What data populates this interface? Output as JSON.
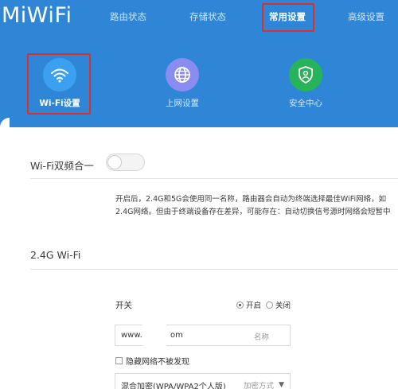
{
  "header": {
    "logo": "MiWiFi",
    "nav": [
      {
        "label": "路由状态"
      },
      {
        "label": "存储状态"
      },
      {
        "label": "常用设置"
      },
      {
        "label": "高级设置"
      }
    ],
    "tiles": [
      {
        "label": "Wi-Fi设置",
        "icon": "wifi-icon",
        "color": "#3ca0f0"
      },
      {
        "label": "上网设置",
        "icon": "globe-icon",
        "color": "#8a8cf2"
      },
      {
        "label": "安全中心",
        "icon": "shield-icon",
        "color": "#26b35a"
      }
    ]
  },
  "colors": {
    "header_bg": "#2f86d6",
    "highlight": "#d9312e"
  },
  "dual_band": {
    "title": "Wi-Fi双频合一",
    "description_line1": "开启后，2.4G和5G会使用同一名称，路由器会自动为终端选择最佳WiFi网络，如",
    "description_line2": "2.4G网络。但由于终端设备存在差异，可能存在：自动切换信号源时网络会短暂中"
  },
  "wifi24": {
    "title": "2.4G Wi-Fi",
    "switch_label": "开关",
    "on_label": "开启",
    "off_label": "关闭",
    "name_value_prefix": "www.",
    "name_value_suffix": "om",
    "name_placeholder": "名称",
    "hide_network_label": "隐藏网络不被发现",
    "encryption_value": "混合加密(WPA/WPA2个人版)",
    "encryption_placeholder": "加密方式"
  }
}
